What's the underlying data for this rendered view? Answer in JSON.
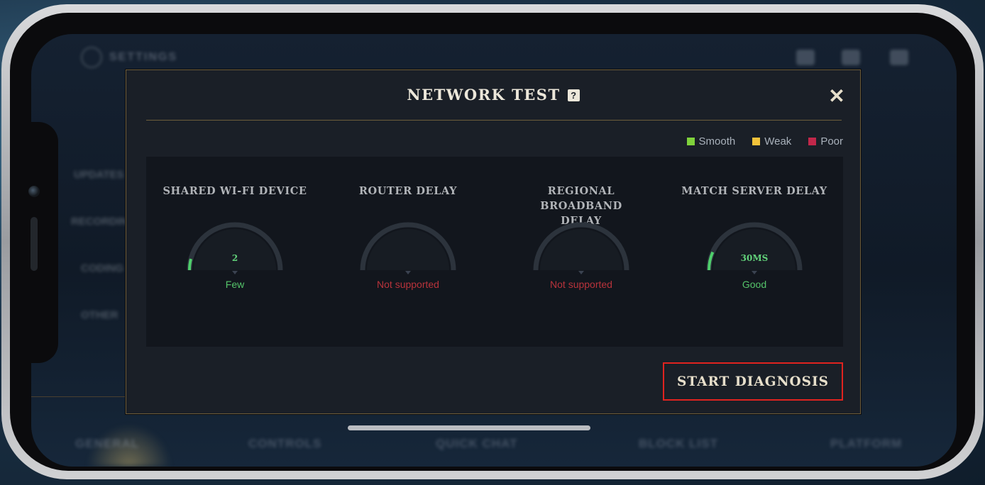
{
  "background": {
    "title": "SETTINGS",
    "side_items": [
      "UPDATES",
      "RECORDING",
      "CODING",
      "OTHER"
    ],
    "tabs": [
      "GENERAL",
      "CONTROLS",
      "QUICK CHAT",
      "BLOCK LIST",
      "PLATFORM"
    ]
  },
  "dialog": {
    "title": "NETWORK TEST",
    "help_glyph": "?",
    "close_glyph": "✕",
    "legend": [
      {
        "label": "Smooth",
        "color": "#7fd13b"
      },
      {
        "label": "Weak",
        "color": "#f2c23a"
      },
      {
        "label": "Poor",
        "color": "#c1274a"
      }
    ],
    "metrics": [
      {
        "label": "SHARED WI-FI DEVICE",
        "value": "2",
        "status": "Few",
        "status_color": "#55c46a",
        "fill": 0.08
      },
      {
        "label": "ROUTER DELAY",
        "value": "",
        "status": "Not supported",
        "status_color": "#b8333b",
        "fill": 0
      },
      {
        "label": "REGIONAL BROADBAND DELAY",
        "value": "",
        "status": "Not supported",
        "status_color": "#b8333b",
        "fill": 0
      },
      {
        "label": "MATCH SERVER DELAY",
        "value": "30MS",
        "status": "Good",
        "status_color": "#55c46a",
        "fill": 0.13
      }
    ],
    "start_button": "START DIAGNOSIS"
  },
  "colors": {
    "gauge_fill": "#4fcf6c",
    "gauge_track": "#2c333c",
    "accent_gold": "#6d5d3b",
    "highlight_red": "#e0231f"
  }
}
